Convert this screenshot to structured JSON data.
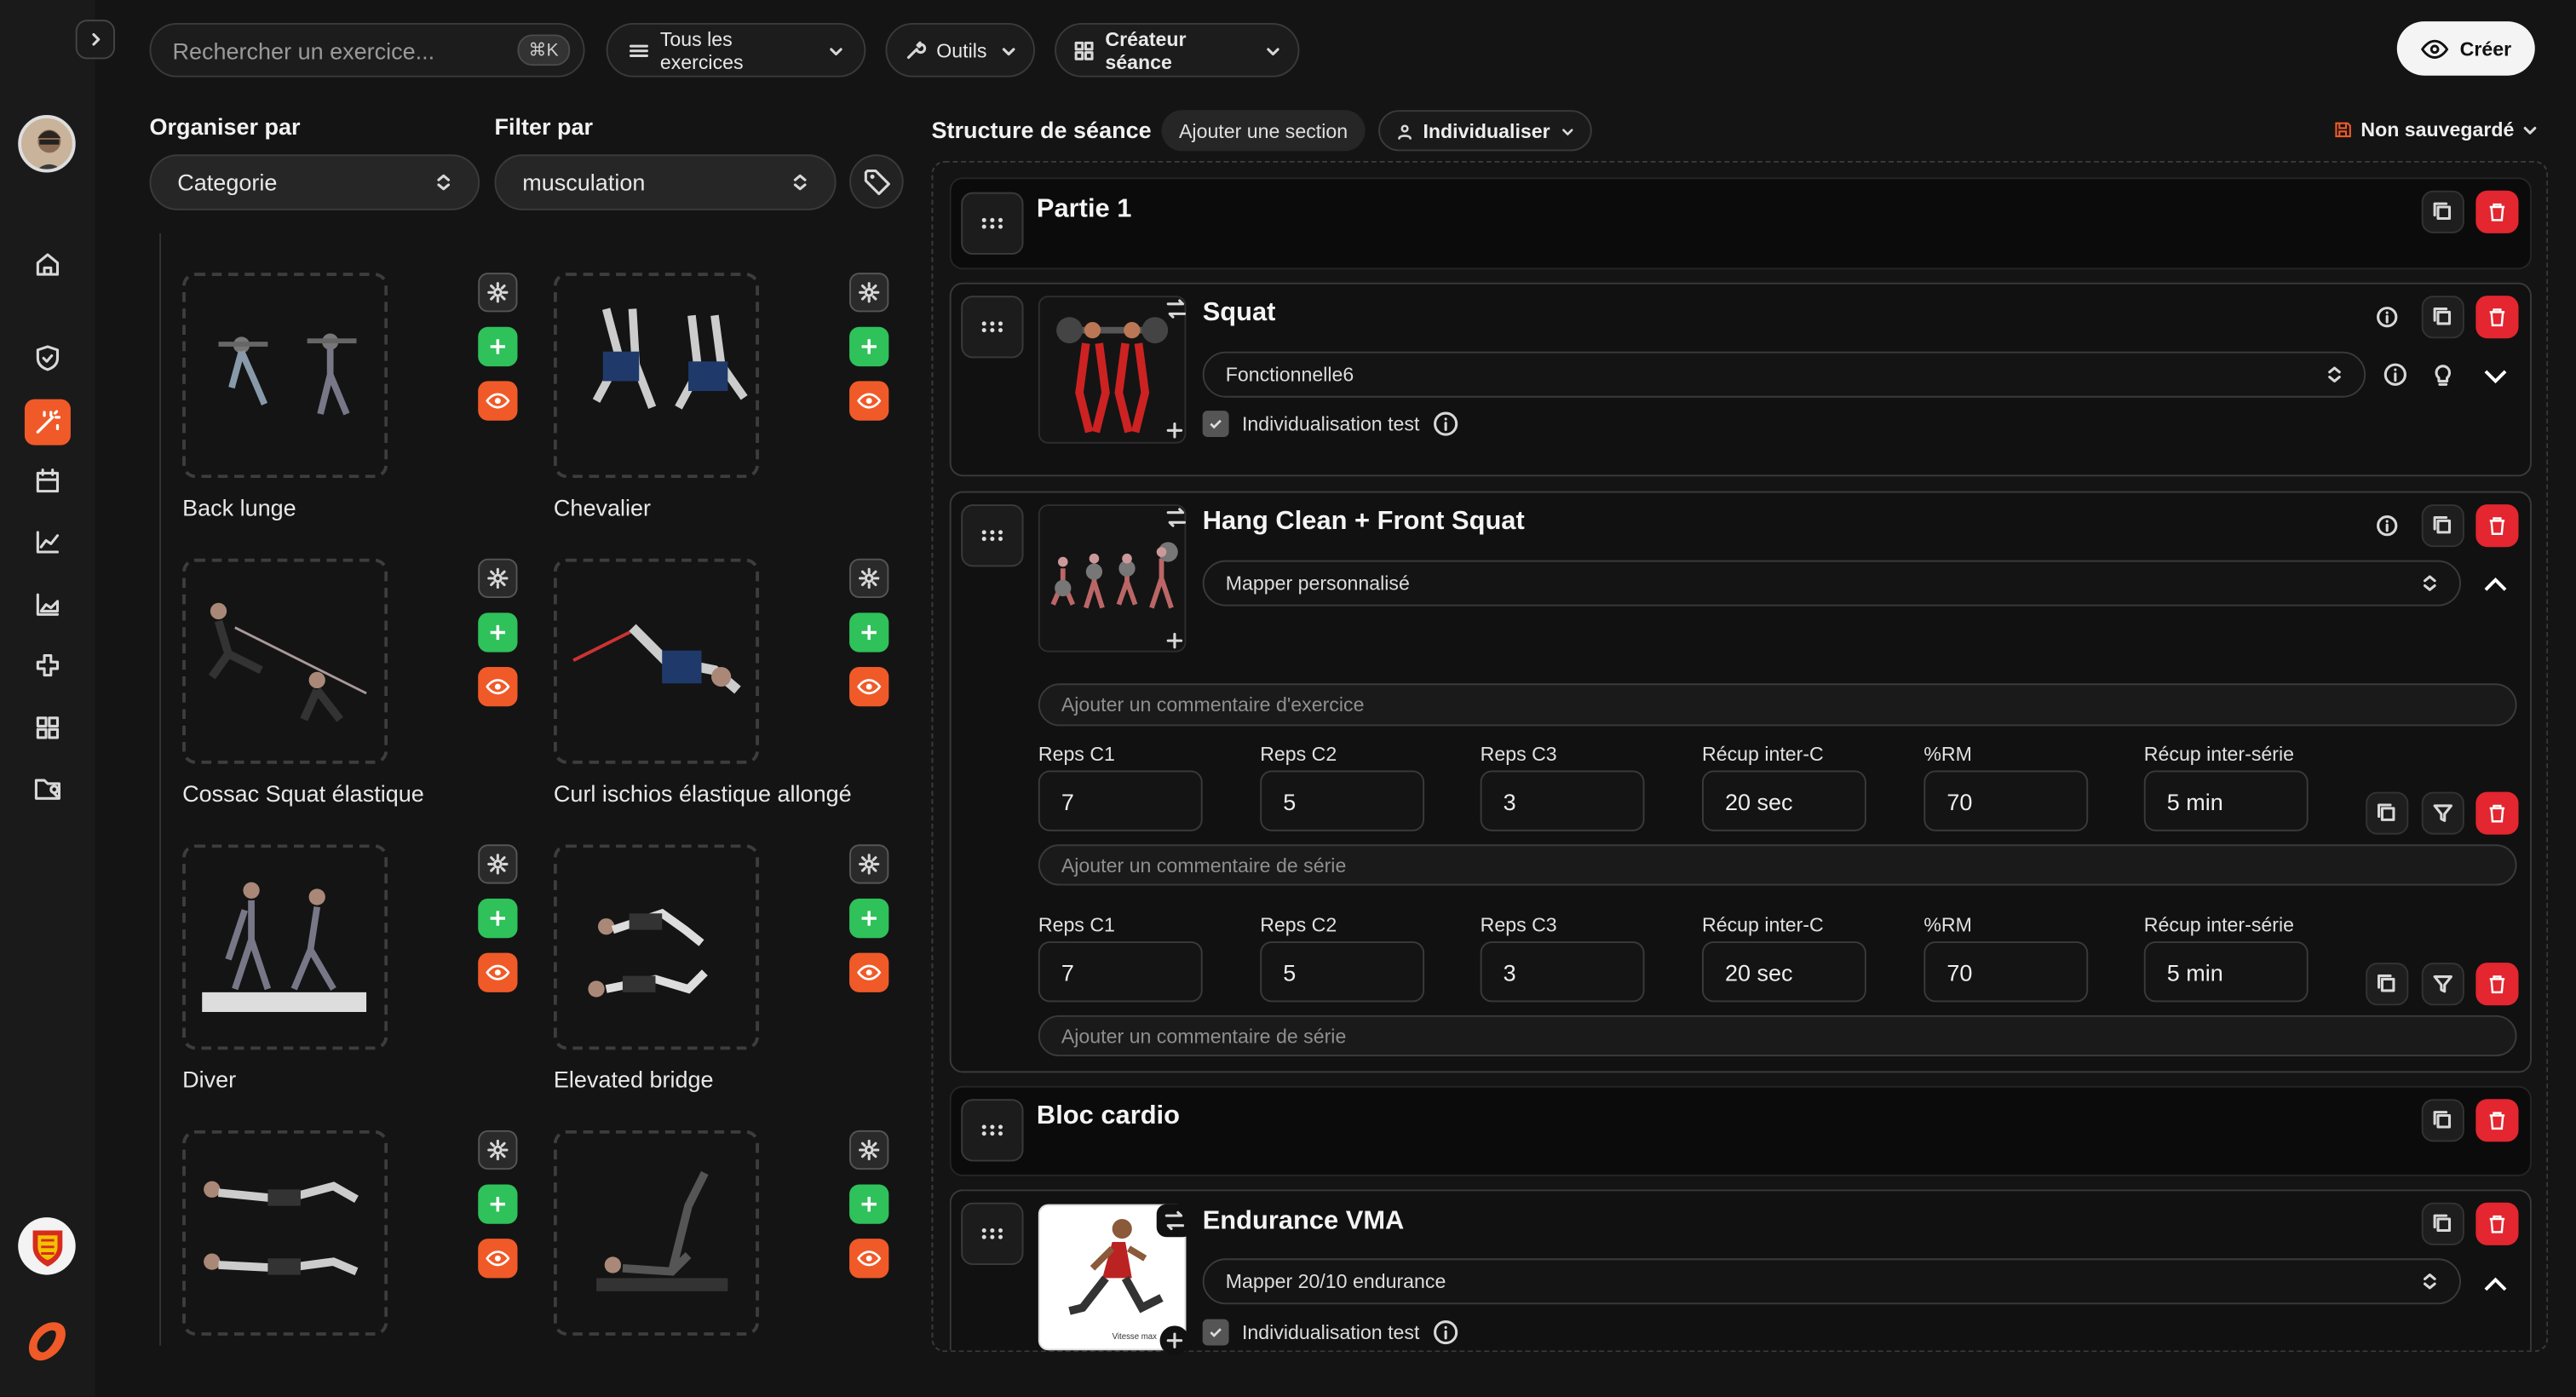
{
  "toolbar": {
    "search_placeholder": "Rechercher un exercice...",
    "search_shortcut": "⌘K",
    "filter_all": "Tous les exercices",
    "tools": "Outils",
    "session_creator": "Créateur séance",
    "create": "Créer"
  },
  "library": {
    "organize_label": "Organiser par",
    "filter_label": "Filter par",
    "organize_value": "Categorie",
    "filter_value": "musculation",
    "exercises": [
      {
        "name": "Back lunge"
      },
      {
        "name": "Chevalier"
      },
      {
        "name": "Cossac Squat élastique"
      },
      {
        "name": "Curl ischios élastique allongé"
      },
      {
        "name": "Diver"
      },
      {
        "name": "Elevated bridge"
      },
      {
        "name": ""
      },
      {
        "name": ""
      }
    ]
  },
  "structure": {
    "title": "Structure de séance",
    "add_section": "Ajouter une section",
    "individualize": "Individualiser",
    "save_status": "Non sauvegardé"
  },
  "sections": {
    "part1": "Partie 1",
    "cardio": "Bloc cardio"
  },
  "squat": {
    "name": "Squat",
    "mapper": "Fonctionnelle6",
    "indiv": "Individualisation test"
  },
  "hang": {
    "name": "Hang Clean + Front Squat",
    "mapper": "Mapper personnalisé",
    "comment_placeholder": "Ajouter un commentaire d'exercice",
    "rows": [
      {
        "fields": [
          {
            "label": "Reps C1",
            "value": "7"
          },
          {
            "label": "Reps C2",
            "value": "5"
          },
          {
            "label": "Reps C3",
            "value": "3"
          },
          {
            "label": "Récup inter-C",
            "value": "20 sec"
          },
          {
            "label": "%RM",
            "value": "70"
          },
          {
            "label": "Récup inter-série",
            "value": "5 min"
          }
        ],
        "comment_placeholder": "Ajouter un commentaire de série"
      },
      {
        "fields": [
          {
            "label": "Reps C1",
            "value": "7"
          },
          {
            "label": "Reps C2",
            "value": "5"
          },
          {
            "label": "Reps C3",
            "value": "3"
          },
          {
            "label": "Récup inter-C",
            "value": "20 sec"
          },
          {
            "label": "%RM",
            "value": "70"
          },
          {
            "label": "Récup inter-série",
            "value": "5 min"
          }
        ],
        "comment_placeholder": "Ajouter un commentaire de série"
      }
    ]
  },
  "endurance": {
    "name": "Endurance VMA",
    "mapper": "Mapper 20/10 endurance",
    "indiv": "Individualisation test",
    "thumb_caption": "Vitesse max"
  },
  "colors": {
    "accent": "#f05a28",
    "green": "#2fc15a",
    "red": "#e3262f"
  }
}
